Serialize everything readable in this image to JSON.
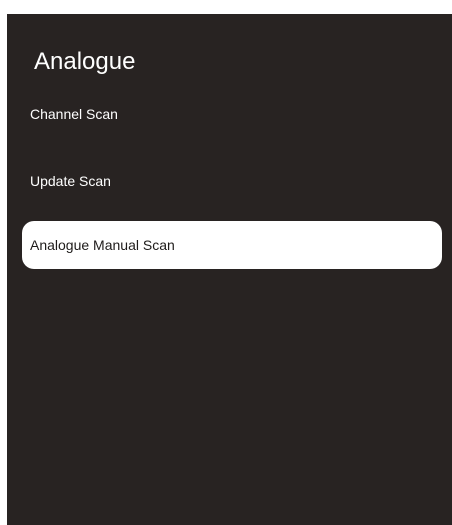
{
  "screen": {
    "title": "Analogue",
    "background_color": "#282322",
    "highlight_color": "#ffffff"
  },
  "menu": {
    "items": [
      {
        "label": "Channel Scan",
        "selected": false
      },
      {
        "label": "Update Scan",
        "selected": false
      },
      {
        "label": "Analogue Manual Scan",
        "selected": true
      }
    ]
  }
}
